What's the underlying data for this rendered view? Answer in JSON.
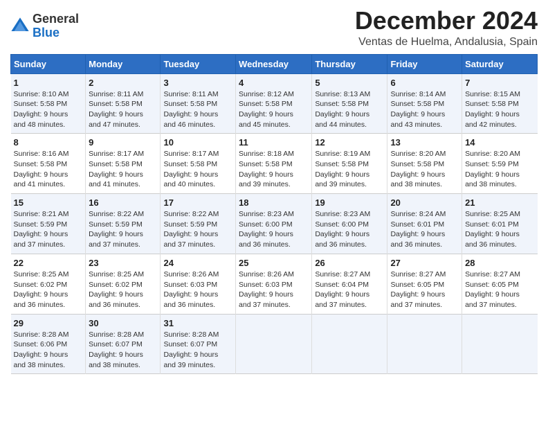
{
  "header": {
    "logo_general": "General",
    "logo_blue": "Blue",
    "month": "December 2024",
    "location": "Ventas de Huelma, Andalusia, Spain"
  },
  "columns": [
    "Sunday",
    "Monday",
    "Tuesday",
    "Wednesday",
    "Thursday",
    "Friday",
    "Saturday"
  ],
  "weeks": [
    [
      {
        "day": "1",
        "info": "Sunrise: 8:10 AM\nSunset: 5:58 PM\nDaylight: 9 hours\nand 48 minutes."
      },
      {
        "day": "2",
        "info": "Sunrise: 8:11 AM\nSunset: 5:58 PM\nDaylight: 9 hours\nand 47 minutes."
      },
      {
        "day": "3",
        "info": "Sunrise: 8:11 AM\nSunset: 5:58 PM\nDaylight: 9 hours\nand 46 minutes."
      },
      {
        "day": "4",
        "info": "Sunrise: 8:12 AM\nSunset: 5:58 PM\nDaylight: 9 hours\nand 45 minutes."
      },
      {
        "day": "5",
        "info": "Sunrise: 8:13 AM\nSunset: 5:58 PM\nDaylight: 9 hours\nand 44 minutes."
      },
      {
        "day": "6",
        "info": "Sunrise: 8:14 AM\nSunset: 5:58 PM\nDaylight: 9 hours\nand 43 minutes."
      },
      {
        "day": "7",
        "info": "Sunrise: 8:15 AM\nSunset: 5:58 PM\nDaylight: 9 hours\nand 42 minutes."
      }
    ],
    [
      {
        "day": "8",
        "info": "Sunrise: 8:16 AM\nSunset: 5:58 PM\nDaylight: 9 hours\nand 41 minutes."
      },
      {
        "day": "9",
        "info": "Sunrise: 8:17 AM\nSunset: 5:58 PM\nDaylight: 9 hours\nand 41 minutes."
      },
      {
        "day": "10",
        "info": "Sunrise: 8:17 AM\nSunset: 5:58 PM\nDaylight: 9 hours\nand 40 minutes."
      },
      {
        "day": "11",
        "info": "Sunrise: 8:18 AM\nSunset: 5:58 PM\nDaylight: 9 hours\nand 39 minutes."
      },
      {
        "day": "12",
        "info": "Sunrise: 8:19 AM\nSunset: 5:58 PM\nDaylight: 9 hours\nand 39 minutes."
      },
      {
        "day": "13",
        "info": "Sunrise: 8:20 AM\nSunset: 5:58 PM\nDaylight: 9 hours\nand 38 minutes."
      },
      {
        "day": "14",
        "info": "Sunrise: 8:20 AM\nSunset: 5:59 PM\nDaylight: 9 hours\nand 38 minutes."
      }
    ],
    [
      {
        "day": "15",
        "info": "Sunrise: 8:21 AM\nSunset: 5:59 PM\nDaylight: 9 hours\nand 37 minutes."
      },
      {
        "day": "16",
        "info": "Sunrise: 8:22 AM\nSunset: 5:59 PM\nDaylight: 9 hours\nand 37 minutes."
      },
      {
        "day": "17",
        "info": "Sunrise: 8:22 AM\nSunset: 5:59 PM\nDaylight: 9 hours\nand 37 minutes."
      },
      {
        "day": "18",
        "info": "Sunrise: 8:23 AM\nSunset: 6:00 PM\nDaylight: 9 hours\nand 36 minutes."
      },
      {
        "day": "19",
        "info": "Sunrise: 8:23 AM\nSunset: 6:00 PM\nDaylight: 9 hours\nand 36 minutes."
      },
      {
        "day": "20",
        "info": "Sunrise: 8:24 AM\nSunset: 6:01 PM\nDaylight: 9 hours\nand 36 minutes."
      },
      {
        "day": "21",
        "info": "Sunrise: 8:25 AM\nSunset: 6:01 PM\nDaylight: 9 hours\nand 36 minutes."
      }
    ],
    [
      {
        "day": "22",
        "info": "Sunrise: 8:25 AM\nSunset: 6:02 PM\nDaylight: 9 hours\nand 36 minutes."
      },
      {
        "day": "23",
        "info": "Sunrise: 8:25 AM\nSunset: 6:02 PM\nDaylight: 9 hours\nand 36 minutes."
      },
      {
        "day": "24",
        "info": "Sunrise: 8:26 AM\nSunset: 6:03 PM\nDaylight: 9 hours\nand 36 minutes."
      },
      {
        "day": "25",
        "info": "Sunrise: 8:26 AM\nSunset: 6:03 PM\nDaylight: 9 hours\nand 37 minutes."
      },
      {
        "day": "26",
        "info": "Sunrise: 8:27 AM\nSunset: 6:04 PM\nDaylight: 9 hours\nand 37 minutes."
      },
      {
        "day": "27",
        "info": "Sunrise: 8:27 AM\nSunset: 6:05 PM\nDaylight: 9 hours\nand 37 minutes."
      },
      {
        "day": "28",
        "info": "Sunrise: 8:27 AM\nSunset: 6:05 PM\nDaylight: 9 hours\nand 37 minutes."
      }
    ],
    [
      {
        "day": "29",
        "info": "Sunrise: 8:28 AM\nSunset: 6:06 PM\nDaylight: 9 hours\nand 38 minutes."
      },
      {
        "day": "30",
        "info": "Sunrise: 8:28 AM\nSunset: 6:07 PM\nDaylight: 9 hours\nand 38 minutes."
      },
      {
        "day": "31",
        "info": "Sunrise: 8:28 AM\nSunset: 6:07 PM\nDaylight: 9 hours\nand 39 minutes."
      },
      {
        "day": "",
        "info": ""
      },
      {
        "day": "",
        "info": ""
      },
      {
        "day": "",
        "info": ""
      },
      {
        "day": "",
        "info": ""
      }
    ]
  ]
}
